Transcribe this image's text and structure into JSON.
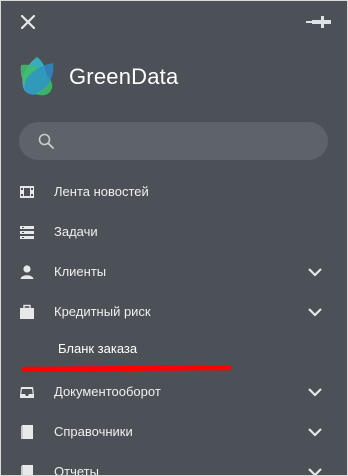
{
  "brand": {
    "name": "GreenData"
  },
  "search": {
    "placeholder": "",
    "value": ""
  },
  "menu": {
    "items": [
      {
        "label": "Лента новостей",
        "icon": "film-icon",
        "expandable": false
      },
      {
        "label": "Задачи",
        "icon": "tasks-icon",
        "expandable": false
      },
      {
        "label": "Клиенты",
        "icon": "user-icon",
        "expandable": true
      },
      {
        "label": "Кредитный риск",
        "icon": "briefcase-icon",
        "expandable": true,
        "expanded": true,
        "children": [
          {
            "label": "Бланк заказа"
          }
        ]
      },
      {
        "label": "Документооборот",
        "icon": "inbox-icon",
        "expandable": true
      },
      {
        "label": "Справочники",
        "icon": "book-icon",
        "expandable": true
      },
      {
        "label": "Отчеты",
        "icon": "report-icon",
        "expandable": true
      }
    ]
  },
  "colors": {
    "sidebar_bg": "#4b5156",
    "search_bg": "#5d6369",
    "text": "#eef0f1",
    "annotation_underline": "#ff0000"
  }
}
